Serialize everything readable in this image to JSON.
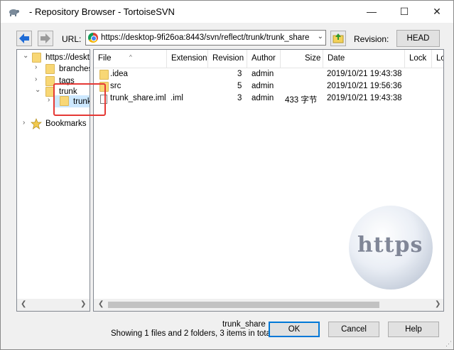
{
  "window": {
    "title": "- Repository Browser - TortoiseSVN",
    "minimize_glyph": "—",
    "maximize_glyph": "☐",
    "close_glyph": "✕"
  },
  "toolbar": {
    "back_icon": "arrow-left-icon",
    "forward_icon": "arrow-right-icon",
    "url_label": "URL:",
    "url_value": "https://desktop-9fi26oa:8443/svn/reflect/trunk/trunk_share",
    "revision_label": "Revision:",
    "revision_button": "HEAD"
  },
  "tree": {
    "items": [
      {
        "label": "https://deskt",
        "expander": "⌄"
      },
      {
        "label": "branches",
        "expander": "›"
      },
      {
        "label": "tags",
        "expander": "›"
      },
      {
        "label": "trunk",
        "expander": "⌄"
      },
      {
        "label": "trunk",
        "expander": "›"
      },
      {
        "label": "Bookmarks",
        "expander": "›"
      }
    ]
  },
  "list": {
    "columns": [
      "File",
      "Extension",
      "Revision",
      "Author",
      "Size",
      "Date",
      "Lock",
      "Lo"
    ],
    "rows": [
      {
        "file": ".idea",
        "extension": "",
        "revision": "3",
        "author": "admin",
        "size": "",
        "date": "2019/10/21 19:43:38",
        "type": "folder"
      },
      {
        "file": "src",
        "extension": "",
        "revision": "5",
        "author": "admin",
        "size": "",
        "date": "2019/10/21 19:56:36",
        "type": "folder"
      },
      {
        "file": "trunk_share.iml",
        "extension": ".iml",
        "revision": "3",
        "author": "admin",
        "size": "433 字节",
        "date": "2019/10/21 19:43:38",
        "type": "file"
      }
    ]
  },
  "watermark": {
    "text": "https"
  },
  "status": {
    "path": "trunk_share",
    "summary": "Showing 1 files and 2 folders, 3 items in total"
  },
  "buttons": {
    "ok": "OK",
    "cancel": "Cancel",
    "help": "Help"
  },
  "colors": {
    "selection": "#cce8ff",
    "highlight_box": "#e53935",
    "default_button_border": "#0078d7"
  }
}
